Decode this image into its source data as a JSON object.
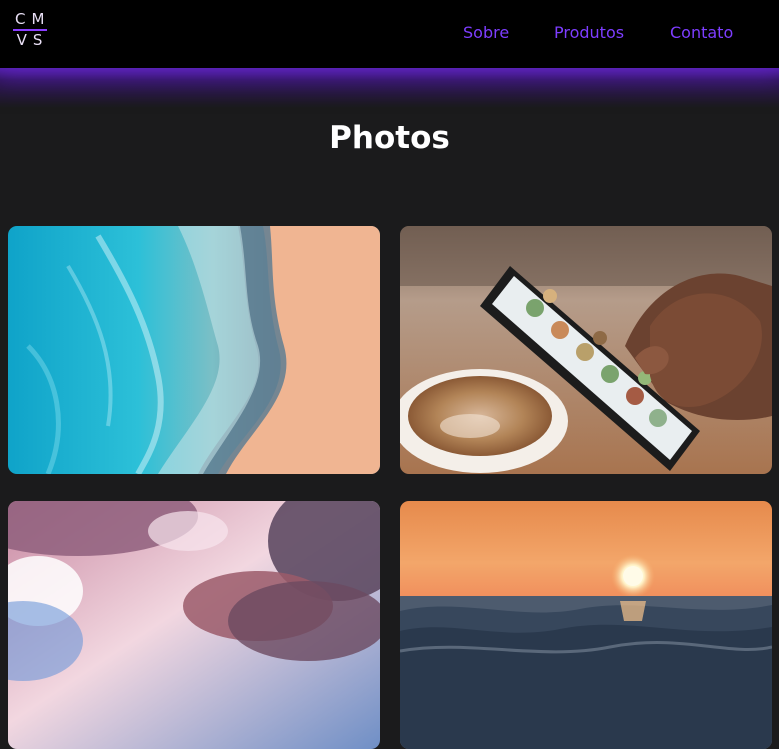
{
  "logo": {
    "line1": "CM",
    "line2": "VS"
  },
  "nav": {
    "items": [
      "Sobre",
      "Produtos",
      "Contato"
    ]
  },
  "page": {
    "title": "Photos"
  },
  "photos": [
    {
      "subject": "aerial view of ocean waves on sand beach"
    },
    {
      "subject": "hand holding smartphone over coffee cup"
    },
    {
      "subject": "pink clouds in blue sky"
    },
    {
      "subject": "sunset over ocean waves"
    }
  ],
  "colors": {
    "background": "#1b1b1c",
    "header": "#000000",
    "accent": "#7d3dff",
    "glow": "#4a1d9a",
    "title": "#ffffff"
  }
}
